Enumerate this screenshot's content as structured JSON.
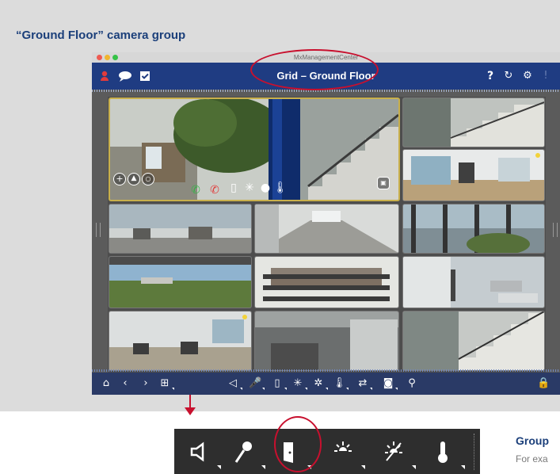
{
  "heading": "“Ground Floor” camera group",
  "window": {
    "title": "MxManagementCenter",
    "view_title": "Grid – Ground Floor",
    "topbar_left_icons": [
      "alarm-user-icon",
      "chat-icon",
      "checkbox-icon"
    ],
    "topbar_right_icons": [
      "help-icon",
      "refresh-icon",
      "settings-gear-icon",
      "exclamation-icon"
    ]
  },
  "colors": {
    "heading": "#1b3f7a",
    "app_bar": "#1f3c82",
    "highlight_circle": "#c8102e",
    "active_camera_frame": "#c9b04c",
    "status_dot": "#f2d23a"
  },
  "camera_grid": {
    "cameras": [
      {
        "scene": "staircase-hallway-plant",
        "selected": true,
        "status_dot": false
      },
      {
        "scene": "staircase-top",
        "selected": false,
        "status_dot": false
      },
      {
        "scene": "corridor-wide",
        "selected": false,
        "status_dot": true
      },
      {
        "scene": "office-fisheye-1",
        "selected": false,
        "status_dot": false
      },
      {
        "scene": "hallway-floor",
        "selected": false,
        "status_dot": false
      },
      {
        "scene": "exterior-windows",
        "selected": false,
        "status_dot": false
      },
      {
        "scene": "outdoor-landscape",
        "selected": false,
        "status_dot": false
      },
      {
        "scene": "classroom",
        "selected": false,
        "status_dot": false
      },
      {
        "scene": "parking-lot",
        "selected": false,
        "status_dot": false
      },
      {
        "scene": "lobby-chairs",
        "selected": false,
        "status_dot": true
      },
      {
        "scene": "foyer-dark",
        "selected": false,
        "status_dot": false
      },
      {
        "scene": "staircase-bottom",
        "selected": false,
        "status_dot": false
      }
    ],
    "overlay_icons": [
      "add-icon",
      "mountain-icon",
      "record-icon",
      "phone-accept-icon",
      "phone-hangup-icon",
      "door-icon",
      "light-on-icon",
      "bulb-icon",
      "thermometer-icon",
      "snapshot-icon"
    ]
  },
  "bottom_toolbar": {
    "icons": [
      "home-icon",
      "previous-icon",
      "next-icon",
      "layout-icon",
      "speaker-icon",
      "microphone-icon",
      "door-icon",
      "light-on-icon",
      "light-off-icon",
      "thermometer-icon",
      "transfer-icon",
      "camera-icon",
      "link-icon",
      "lock-icon"
    ]
  },
  "zoom_bar": {
    "icons": [
      "speaker-icon",
      "microphone-icon",
      "door-icon",
      "light-on-icon",
      "light-off-icon",
      "thermometer-icon"
    ],
    "highlighted": "door-icon"
  },
  "side_panel": {
    "title": "Group",
    "text": "For exa"
  }
}
